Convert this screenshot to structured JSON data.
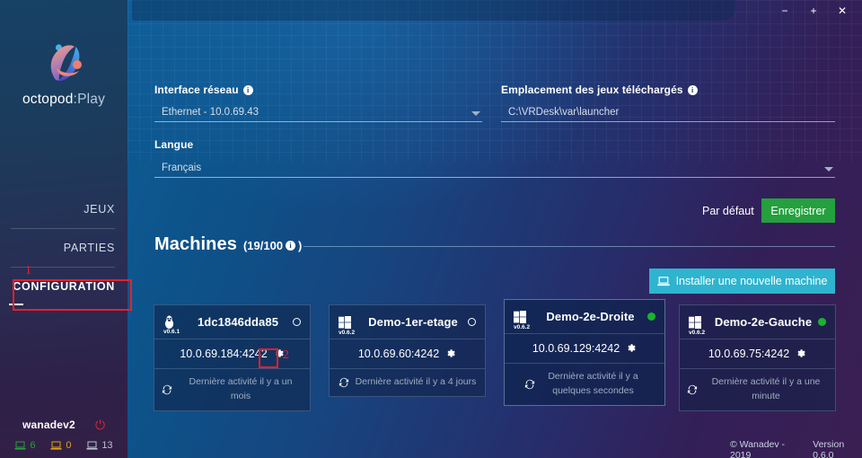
{
  "window": {
    "minimize_label": "−",
    "maximize_label": "+",
    "close_label": "✕"
  },
  "sidebar": {
    "logo_text_main": "octopod",
    "logo_text_sep": ":",
    "logo_text_play": "Play",
    "nav": [
      {
        "label": "JEUX",
        "active": false
      },
      {
        "label": "PARTIES",
        "active": false
      },
      {
        "label": "CONFIGURATION",
        "active": true
      }
    ],
    "user": {
      "name": "wanadev2",
      "power_icon": "power-icon"
    },
    "stats": [
      {
        "icon": "laptop-icon",
        "value": "6",
        "color": "#25a03c"
      },
      {
        "icon": "laptop-icon",
        "value": "0",
        "color": "#dfa310"
      },
      {
        "icon": "desktop-icon",
        "value": "13",
        "color": "#b9c2cf"
      }
    ]
  },
  "settings": {
    "network_label": "Interface réseau",
    "network_value": "Ethernet - 10.0.69.43",
    "games_location_label": "Emplacement des jeux téléchargés",
    "games_location_value": "C:\\VRDesk\\var\\launcher",
    "language_label": "Langue",
    "language_value": "Français",
    "info_glyph": "i",
    "default_button": "Par défaut",
    "save_button": "Enregistrer"
  },
  "machines": {
    "title": "Machines",
    "count": "(19/100",
    "count_close": ")",
    "install_button": "Installer une nouvelle machine",
    "cards": [
      {
        "os": "linux",
        "version": "v0.6.1",
        "name": "1dc1846dda85",
        "status": "off",
        "ip": "10.0.69.184:4242",
        "activity": "Dernière activité il y a un mois",
        "selected": false
      },
      {
        "os": "windows",
        "version": "v0.6.2",
        "name": "Demo-1er-etage",
        "status": "off",
        "ip": "10.0.69.60:4242",
        "activity": "Dernière activité il y a 4 jours",
        "selected": false
      },
      {
        "os": "windows",
        "version": "v0.6.2",
        "name": "Demo-2e-Droite",
        "status": "on",
        "ip": "10.0.69.129:4242",
        "activity": "Dernière activité il y a quelques secondes",
        "selected": true
      },
      {
        "os": "windows",
        "version": "v0.6.2",
        "name": "Demo-2e-Gauche",
        "status": "on",
        "ip": "10.0.69.75:4242",
        "activity": "Dernière activité il y a une minute",
        "selected": false
      }
    ]
  },
  "footer": {
    "copyright": "© Wanadev - 2019",
    "version": "Version 0.6.0"
  },
  "annotations": [
    {
      "number": "1",
      "target": "sidebar-item-configuration"
    },
    {
      "number": "2",
      "target": "card-gear-icon-1"
    }
  ],
  "colors": {
    "accent_green": "#24a03e",
    "accent_cyan": "#2fb4cf",
    "status_online": "#18b52c",
    "annotation_red": "#e8202a"
  }
}
